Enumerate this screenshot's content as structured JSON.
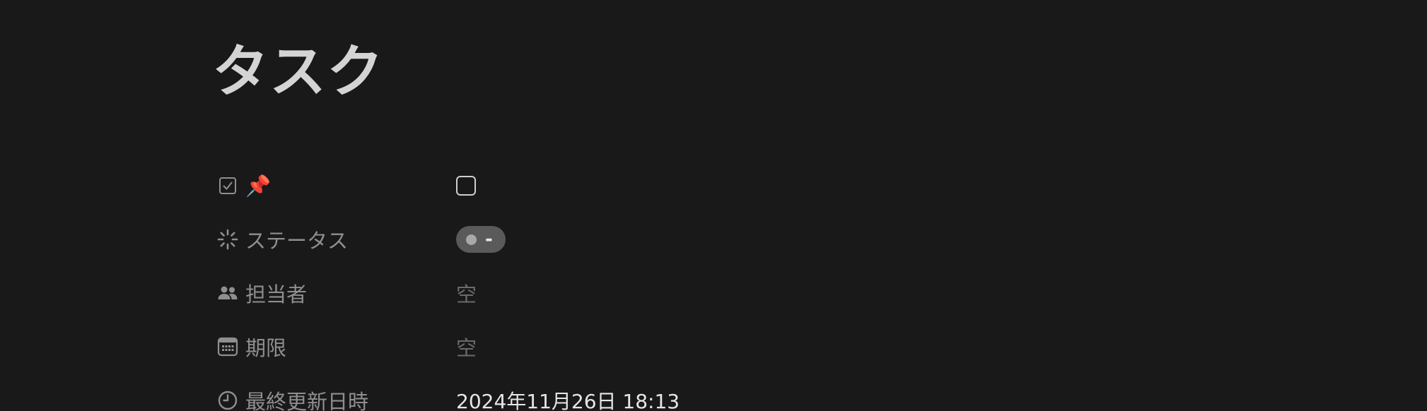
{
  "page": {
    "title": "タスク"
  },
  "properties": [
    {
      "icon": "checkbox-icon",
      "label": "📌",
      "value_type": "checkbox",
      "checked": false
    },
    {
      "icon": "status-spinner-icon",
      "label": "ステータス",
      "value_type": "status",
      "value": "-",
      "color": "#5a5a5a"
    },
    {
      "icon": "people-icon",
      "label": "担当者",
      "value_type": "empty",
      "value": "空"
    },
    {
      "icon": "calendar-icon",
      "label": "期限",
      "value_type": "empty",
      "value": "空"
    },
    {
      "icon": "clock-icon",
      "label": "最終更新日時",
      "value_type": "datetime",
      "value": "2024年11月26日 18:13"
    }
  ],
  "colors": {
    "background": "#191919",
    "title": "#d4d4d4",
    "label": "#8f8f8f",
    "status_badge": "#5a5a5a"
  }
}
